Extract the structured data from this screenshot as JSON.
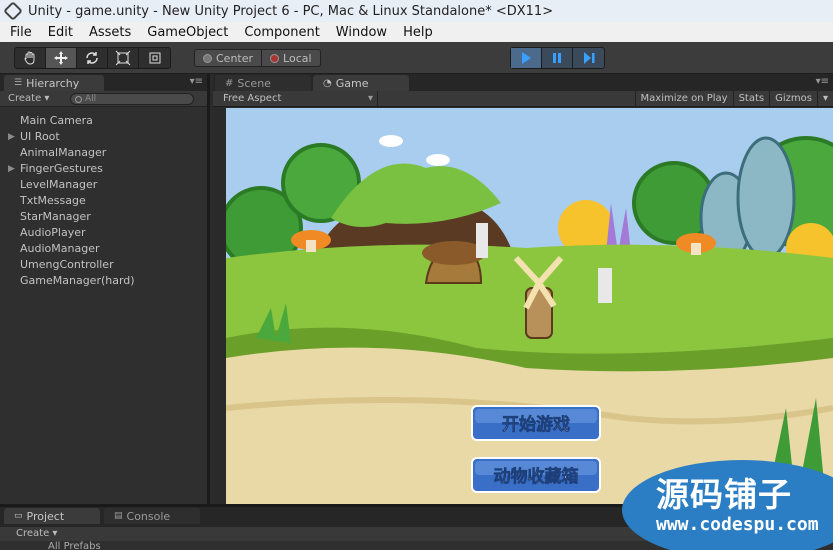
{
  "window": {
    "title": "Unity - game.unity - New Unity Project 6 - PC, Mac & Linux Standalone* <DX11>"
  },
  "menu": [
    "File",
    "Edit",
    "Assets",
    "GameObject",
    "Component",
    "Window",
    "Help"
  ],
  "toolbar": {
    "pivot_center": "Center",
    "pivot_local": "Local"
  },
  "hierarchy": {
    "tab": "Hierarchy",
    "create": "Create",
    "search_placeholder": "All",
    "items": [
      {
        "label": "Main Camera",
        "expandable": false
      },
      {
        "label": "UI Root",
        "expandable": true
      },
      {
        "label": "AnimalManager",
        "expandable": false
      },
      {
        "label": "FingerGestures",
        "expandable": true
      },
      {
        "label": "LevelManager",
        "expandable": false
      },
      {
        "label": "TxtMessage",
        "expandable": false
      },
      {
        "label": "StarManager",
        "expandable": false
      },
      {
        "label": "AudioPlayer",
        "expandable": false
      },
      {
        "label": "AudioManager",
        "expandable": false
      },
      {
        "label": "UmengController",
        "expandable": false
      },
      {
        "label": "GameManager(hard)",
        "expandable": false
      }
    ]
  },
  "view": {
    "tabs": {
      "scene": "Scene",
      "game": "Game"
    },
    "aspect": "Free Aspect",
    "maximize": "Maximize on Play",
    "stats": "Stats",
    "gizmos": "Gizmos"
  },
  "game": {
    "start_button": "开始游戏",
    "collection_button": "动物收藏箱"
  },
  "bottom": {
    "project_tab": "Project",
    "console_tab": "Console",
    "create": "Create",
    "all_prefabs": "All Prefabs"
  },
  "watermark": {
    "name": "源码铺子",
    "url": "www.codespu.com"
  },
  "colors": {
    "play_active": "#4b6a8c",
    "button_blue": "#3a6fc8",
    "grass": "#8cc63f"
  }
}
